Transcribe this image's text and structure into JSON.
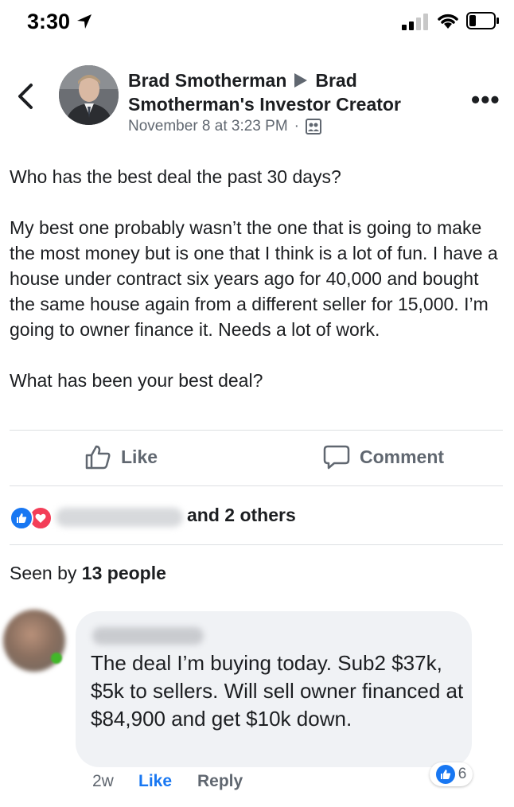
{
  "status_bar": {
    "time": "3:30"
  },
  "post": {
    "author": "Brad Smotherman",
    "group": "Brad Smotherman's Investor Creator",
    "timestamp": "November 8 at 3:23 PM",
    "dot": "·",
    "paragraphs": [
      "Who has the best deal the past 30 days?",
      "My best one probably wasn’t the one that is going to make the most money but is one that I think is a lot of fun. I have a house under contract six years ago for 40,000 and bought the same house again from a different seller for 15,000. I’m going to owner finance it. Needs a lot of work.",
      "What has been your best deal?"
    ]
  },
  "actions": {
    "like_label": "Like",
    "comment_label": "Comment"
  },
  "reactions": {
    "others_text": "and 2 others"
  },
  "seen": {
    "prefix": "Seen by ",
    "count": "13 people"
  },
  "comment": {
    "text": "The deal I’m buying today.  Sub2 $37k, $5k to sellers.  Will sell owner financed at $84,900 and get $10k down.",
    "time": "2w",
    "like_label": "Like",
    "reply_label": "Reply",
    "reaction_count": "6"
  },
  "colors": {
    "facebook_blue": "#1877f2",
    "love_red": "#f33e58",
    "secondary_text": "#606770",
    "bubble_bg": "#f0f2f5"
  },
  "icons": [
    "location-arrow-icon",
    "signal-icon",
    "wifi-icon",
    "battery-icon",
    "back-icon",
    "more-icon",
    "group-icon",
    "thumbs-up-icon",
    "comment-icon",
    "heart-icon"
  ]
}
